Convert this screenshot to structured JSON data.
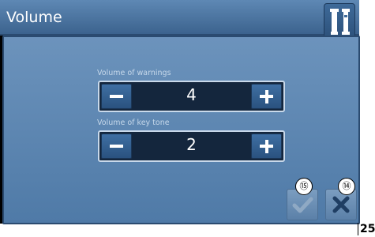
{
  "window": {
    "title": "Volume"
  },
  "controls": [
    {
      "label": "Volume of warnings",
      "value": "4"
    },
    {
      "label": "Volume of key tone",
      "value": "2"
    }
  ],
  "callouts": {
    "confirm": "⑮",
    "cancel": "⑭"
  },
  "page_number": "25",
  "icons": {
    "header": "thread-spool-icon",
    "minus": "minus-icon",
    "plus": "plus-icon",
    "confirm": "checkmark-icon",
    "cancel": "close-icon"
  },
  "colors": {
    "title_bar": "#4a73a0",
    "panel": "#5e87b2",
    "value_field": "#14263d",
    "buttons": "#3a679a"
  }
}
